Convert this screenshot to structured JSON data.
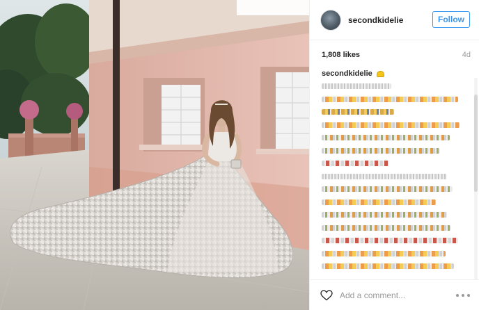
{
  "post": {
    "username": "secondkidelie",
    "follow_label": "Follow",
    "likes": "1,808 likes",
    "time_ago": "4d"
  },
  "caption": {
    "username": "secondkidelie",
    "emoji_icon": "moon-emoji-icon"
  },
  "footer": {
    "comment_placeholder": "Add a comment...",
    "like_icon": "heart-icon",
    "more_icon": "more-options-icon"
  },
  "colors": {
    "accent": "#3897f0",
    "text": "#262626",
    "muted": "#999999",
    "wall": "#e6bfb4"
  }
}
